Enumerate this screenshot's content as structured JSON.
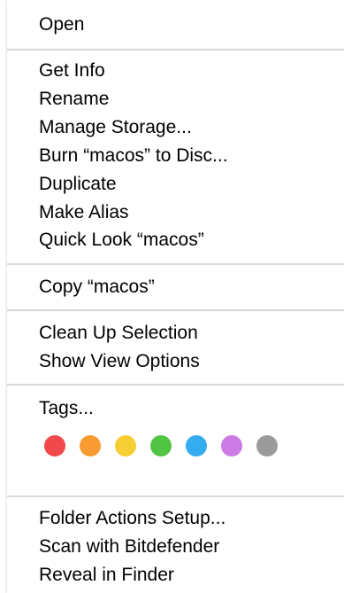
{
  "menu": {
    "open": "Open",
    "get_info": "Get Info",
    "rename": "Rename",
    "manage_storage": "Manage Storage...",
    "burn": "Burn “macos” to Disc...",
    "duplicate": "Duplicate",
    "make_alias": "Make Alias",
    "quick_look": "Quick Look “macos”",
    "copy": "Copy “macos”",
    "clean_up": "Clean Up Selection",
    "show_view_options": "Show View Options",
    "tags": "Tags...",
    "folder_actions": "Folder Actions Setup...",
    "scan": "Scan with Bitdefender",
    "reveal": "Reveal in Finder"
  },
  "tag_colors": [
    {
      "name": "red",
      "color": "#f0484b"
    },
    {
      "name": "orange",
      "color": "#f89b32"
    },
    {
      "name": "yellow",
      "color": "#f6cf34"
    },
    {
      "name": "green",
      "color": "#52c443"
    },
    {
      "name": "blue",
      "color": "#35abf0"
    },
    {
      "name": "purple",
      "color": "#cc7be4"
    },
    {
      "name": "gray",
      "color": "#9b9b9b"
    }
  ]
}
